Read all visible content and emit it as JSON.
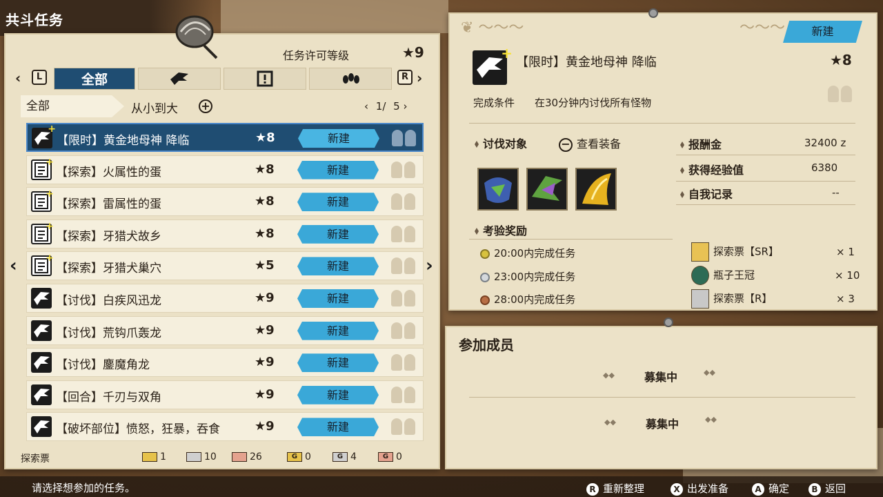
{
  "header": {
    "title": "共斗任务"
  },
  "rank": {
    "label": "任务许可等级",
    "value": "★9"
  },
  "tabs": {
    "left_key": "L",
    "right_key": "R",
    "items": [
      {
        "label": "全部",
        "icon": "all"
      },
      {
        "label": "",
        "icon": "monster-head-icon"
      },
      {
        "label": "",
        "icon": "exclamation-book-icon"
      },
      {
        "label": "",
        "icon": "footprint-icon"
      }
    ]
  },
  "filter": {
    "category": "全部",
    "sort": "从小到大",
    "page": "1/",
    "pages": "5"
  },
  "quests": [
    {
      "icon": "monster-head",
      "name": "【限时】黄金地母神 降临",
      "stars": "★8",
      "status": "新建",
      "selected": true
    },
    {
      "icon": "paper",
      "name": "【探索】火属性的蛋",
      "stars": "★8",
      "status": "新建",
      "selected": false
    },
    {
      "icon": "paper",
      "name": "【探索】雷属性的蛋",
      "stars": "★8",
      "status": "新建",
      "selected": false
    },
    {
      "icon": "paper",
      "name": "【探索】牙猎犬故乡",
      "stars": "★8",
      "status": "新建",
      "selected": false
    },
    {
      "icon": "paper",
      "name": "【探索】牙猎犬巢穴",
      "stars": "★5",
      "status": "新建",
      "selected": false
    },
    {
      "icon": "monster-head",
      "name": "【讨伐】白疾风迅龙",
      "stars": "★9",
      "status": "新建",
      "selected": false
    },
    {
      "icon": "monster-head",
      "name": "【讨伐】荒钩爪轰龙",
      "stars": "★9",
      "status": "新建",
      "selected": false
    },
    {
      "icon": "monster-head",
      "name": "【讨伐】鏖魔角龙",
      "stars": "★9",
      "status": "新建",
      "selected": false
    },
    {
      "icon": "monster-head",
      "name": "【回合】千刃与双角",
      "stars": "★9",
      "status": "新建",
      "selected": false
    },
    {
      "icon": "monster-head",
      "name": "【破坏部位】愤怒，狂暴，吞食",
      "stars": "★9",
      "status": "新建",
      "selected": false
    }
  ],
  "tickets": {
    "label": "探索票",
    "gold": "1",
    "silver": "10",
    "bronze": "26",
    "g_gold": "0",
    "g_silver": "4",
    "g_bronze": "0"
  },
  "detail": {
    "status": "新建",
    "name": "【限时】黄金地母神 降临",
    "stars": "★8",
    "condition_label": "完成条件",
    "condition": "在30分钟内讨伐所有怪物",
    "targets_label": "讨伐对象",
    "equipment_label": "查看装备",
    "reward_label": "报酬金",
    "reward": "32400 z",
    "exp_label": "获得经验值",
    "exp": "6380",
    "record_label": "自我记录",
    "record": "--",
    "challenge_label": "考验奖励",
    "challenges": [
      "20:00内完成任务",
      "23:00内完成任务",
      "28:00内完成任务"
    ],
    "items": [
      {
        "name": "探索票【SR】",
        "qty": "× 1"
      },
      {
        "name": "瓶子王冠",
        "qty": "× 10"
      },
      {
        "name": "探索票【R】",
        "qty": "× 3"
      }
    ]
  },
  "members": {
    "title": "参加成员",
    "slots": [
      "募集中",
      "募集中"
    ]
  },
  "footer": {
    "hint": "请选择想参加的任务。",
    "controls": [
      {
        "key": "R",
        "label": "重新整理"
      },
      {
        "key": "X",
        "label": "出发准备"
      },
      {
        "key": "A",
        "label": "确定"
      },
      {
        "key": "B",
        "label": "返回"
      }
    ]
  }
}
